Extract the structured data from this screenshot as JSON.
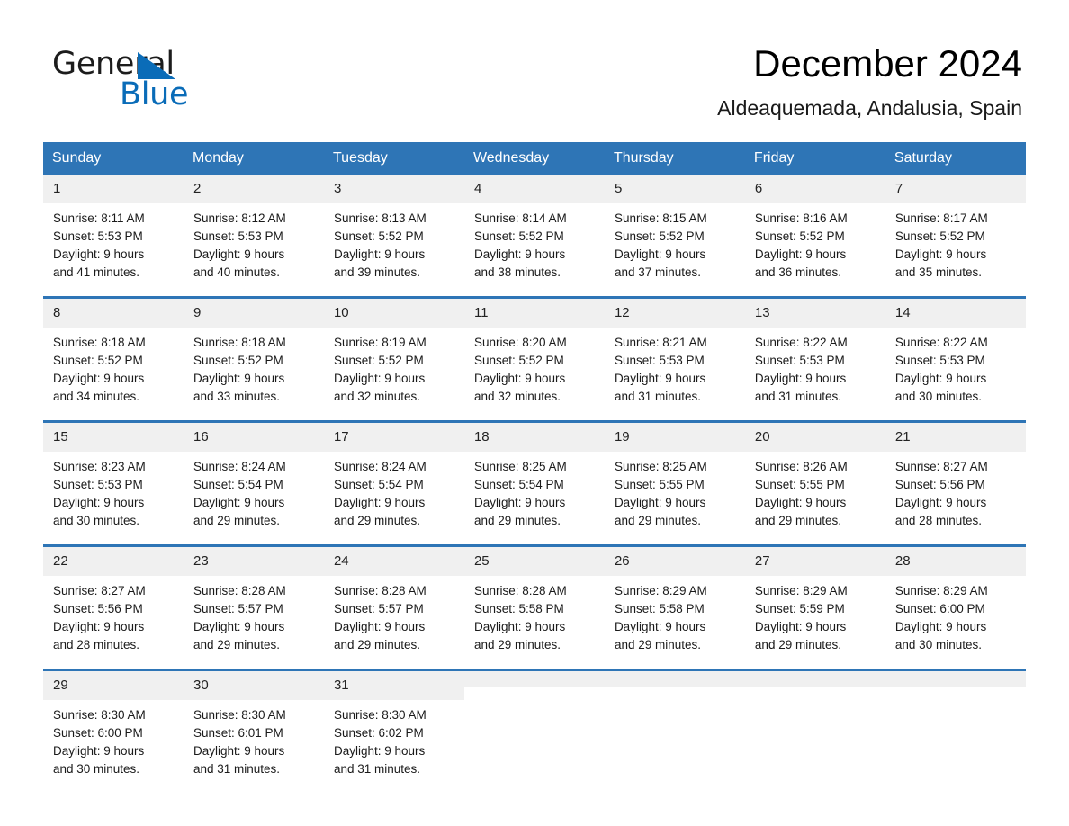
{
  "brand": {
    "name_part1": "General",
    "name_part2": "Blue",
    "accent_color": "#0a6cb8",
    "triangle_icon": "triangle-right-icon"
  },
  "header": {
    "title": "December 2024",
    "subtitle": "Aldeaquemada, Andalusia, Spain"
  },
  "theme": {
    "header_row_color": "#2e75b6",
    "week_divider_color": "#2e75b6",
    "daynum_band_color": "#f0f0f0"
  },
  "weekdays": [
    "Sunday",
    "Monday",
    "Tuesday",
    "Wednesday",
    "Thursday",
    "Friday",
    "Saturday"
  ],
  "weeks": [
    [
      {
        "day": "1",
        "sunrise": "Sunrise: 8:11 AM",
        "sunset": "Sunset: 5:53 PM",
        "daylight1": "Daylight: 9 hours",
        "daylight2": "and 41 minutes."
      },
      {
        "day": "2",
        "sunrise": "Sunrise: 8:12 AM",
        "sunset": "Sunset: 5:53 PM",
        "daylight1": "Daylight: 9 hours",
        "daylight2": "and 40 minutes."
      },
      {
        "day": "3",
        "sunrise": "Sunrise: 8:13 AM",
        "sunset": "Sunset: 5:52 PM",
        "daylight1": "Daylight: 9 hours",
        "daylight2": "and 39 minutes."
      },
      {
        "day": "4",
        "sunrise": "Sunrise: 8:14 AM",
        "sunset": "Sunset: 5:52 PM",
        "daylight1": "Daylight: 9 hours",
        "daylight2": "and 38 minutes."
      },
      {
        "day": "5",
        "sunrise": "Sunrise: 8:15 AM",
        "sunset": "Sunset: 5:52 PM",
        "daylight1": "Daylight: 9 hours",
        "daylight2": "and 37 minutes."
      },
      {
        "day": "6",
        "sunrise": "Sunrise: 8:16 AM",
        "sunset": "Sunset: 5:52 PM",
        "daylight1": "Daylight: 9 hours",
        "daylight2": "and 36 minutes."
      },
      {
        "day": "7",
        "sunrise": "Sunrise: 8:17 AM",
        "sunset": "Sunset: 5:52 PM",
        "daylight1": "Daylight: 9 hours",
        "daylight2": "and 35 minutes."
      }
    ],
    [
      {
        "day": "8",
        "sunrise": "Sunrise: 8:18 AM",
        "sunset": "Sunset: 5:52 PM",
        "daylight1": "Daylight: 9 hours",
        "daylight2": "and 34 minutes."
      },
      {
        "day": "9",
        "sunrise": "Sunrise: 8:18 AM",
        "sunset": "Sunset: 5:52 PM",
        "daylight1": "Daylight: 9 hours",
        "daylight2": "and 33 minutes."
      },
      {
        "day": "10",
        "sunrise": "Sunrise: 8:19 AM",
        "sunset": "Sunset: 5:52 PM",
        "daylight1": "Daylight: 9 hours",
        "daylight2": "and 32 minutes."
      },
      {
        "day": "11",
        "sunrise": "Sunrise: 8:20 AM",
        "sunset": "Sunset: 5:52 PM",
        "daylight1": "Daylight: 9 hours",
        "daylight2": "and 32 minutes."
      },
      {
        "day": "12",
        "sunrise": "Sunrise: 8:21 AM",
        "sunset": "Sunset: 5:53 PM",
        "daylight1": "Daylight: 9 hours",
        "daylight2": "and 31 minutes."
      },
      {
        "day": "13",
        "sunrise": "Sunrise: 8:22 AM",
        "sunset": "Sunset: 5:53 PM",
        "daylight1": "Daylight: 9 hours",
        "daylight2": "and 31 minutes."
      },
      {
        "day": "14",
        "sunrise": "Sunrise: 8:22 AM",
        "sunset": "Sunset: 5:53 PM",
        "daylight1": "Daylight: 9 hours",
        "daylight2": "and 30 minutes."
      }
    ],
    [
      {
        "day": "15",
        "sunrise": "Sunrise: 8:23 AM",
        "sunset": "Sunset: 5:53 PM",
        "daylight1": "Daylight: 9 hours",
        "daylight2": "and 30 minutes."
      },
      {
        "day": "16",
        "sunrise": "Sunrise: 8:24 AM",
        "sunset": "Sunset: 5:54 PM",
        "daylight1": "Daylight: 9 hours",
        "daylight2": "and 29 minutes."
      },
      {
        "day": "17",
        "sunrise": "Sunrise: 8:24 AM",
        "sunset": "Sunset: 5:54 PM",
        "daylight1": "Daylight: 9 hours",
        "daylight2": "and 29 minutes."
      },
      {
        "day": "18",
        "sunrise": "Sunrise: 8:25 AM",
        "sunset": "Sunset: 5:54 PM",
        "daylight1": "Daylight: 9 hours",
        "daylight2": "and 29 minutes."
      },
      {
        "day": "19",
        "sunrise": "Sunrise: 8:25 AM",
        "sunset": "Sunset: 5:55 PM",
        "daylight1": "Daylight: 9 hours",
        "daylight2": "and 29 minutes."
      },
      {
        "day": "20",
        "sunrise": "Sunrise: 8:26 AM",
        "sunset": "Sunset: 5:55 PM",
        "daylight1": "Daylight: 9 hours",
        "daylight2": "and 29 minutes."
      },
      {
        "day": "21",
        "sunrise": "Sunrise: 8:27 AM",
        "sunset": "Sunset: 5:56 PM",
        "daylight1": "Daylight: 9 hours",
        "daylight2": "and 28 minutes."
      }
    ],
    [
      {
        "day": "22",
        "sunrise": "Sunrise: 8:27 AM",
        "sunset": "Sunset: 5:56 PM",
        "daylight1": "Daylight: 9 hours",
        "daylight2": "and 28 minutes."
      },
      {
        "day": "23",
        "sunrise": "Sunrise: 8:28 AM",
        "sunset": "Sunset: 5:57 PM",
        "daylight1": "Daylight: 9 hours",
        "daylight2": "and 29 minutes."
      },
      {
        "day": "24",
        "sunrise": "Sunrise: 8:28 AM",
        "sunset": "Sunset: 5:57 PM",
        "daylight1": "Daylight: 9 hours",
        "daylight2": "and 29 minutes."
      },
      {
        "day": "25",
        "sunrise": "Sunrise: 8:28 AM",
        "sunset": "Sunset: 5:58 PM",
        "daylight1": "Daylight: 9 hours",
        "daylight2": "and 29 minutes."
      },
      {
        "day": "26",
        "sunrise": "Sunrise: 8:29 AM",
        "sunset": "Sunset: 5:58 PM",
        "daylight1": "Daylight: 9 hours",
        "daylight2": "and 29 minutes."
      },
      {
        "day": "27",
        "sunrise": "Sunrise: 8:29 AM",
        "sunset": "Sunset: 5:59 PM",
        "daylight1": "Daylight: 9 hours",
        "daylight2": "and 29 minutes."
      },
      {
        "day": "28",
        "sunrise": "Sunrise: 8:29 AM",
        "sunset": "Sunset: 6:00 PM",
        "daylight1": "Daylight: 9 hours",
        "daylight2": "and 30 minutes."
      }
    ],
    [
      {
        "day": "29",
        "sunrise": "Sunrise: 8:30 AM",
        "sunset": "Sunset: 6:00 PM",
        "daylight1": "Daylight: 9 hours",
        "daylight2": "and 30 minutes."
      },
      {
        "day": "30",
        "sunrise": "Sunrise: 8:30 AM",
        "sunset": "Sunset: 6:01 PM",
        "daylight1": "Daylight: 9 hours",
        "daylight2": "and 31 minutes."
      },
      {
        "day": "31",
        "sunrise": "Sunrise: 8:30 AM",
        "sunset": "Sunset: 6:02 PM",
        "daylight1": "Daylight: 9 hours",
        "daylight2": "and 31 minutes."
      },
      {
        "day": "",
        "sunrise": "",
        "sunset": "",
        "daylight1": "",
        "daylight2": ""
      },
      {
        "day": "",
        "sunrise": "",
        "sunset": "",
        "daylight1": "",
        "daylight2": ""
      },
      {
        "day": "",
        "sunrise": "",
        "sunset": "",
        "daylight1": "",
        "daylight2": ""
      },
      {
        "day": "",
        "sunrise": "",
        "sunset": "",
        "daylight1": "",
        "daylight2": ""
      }
    ]
  ]
}
